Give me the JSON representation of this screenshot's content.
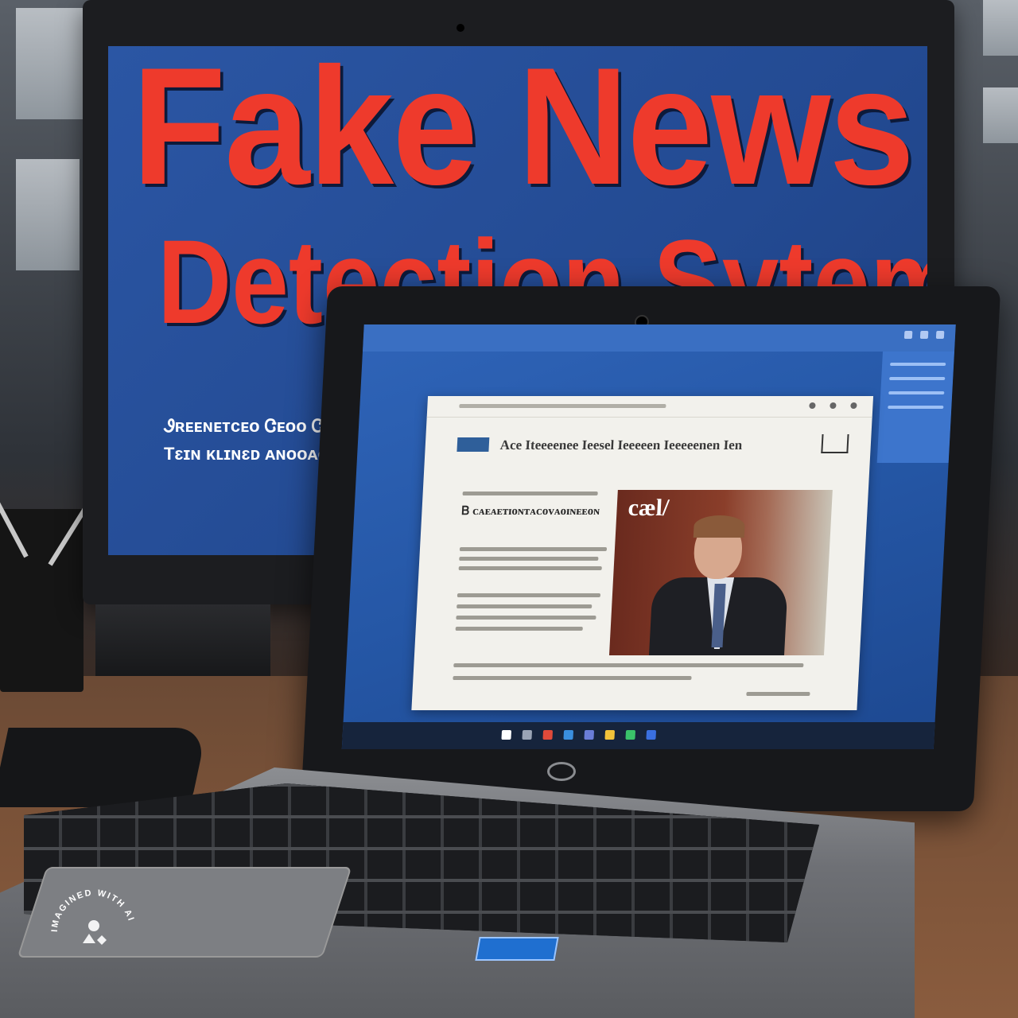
{
  "monitor": {
    "headline_line1": "Fake News",
    "headline_line2": "Detection Sytem",
    "subtitle_line1": "Ꮽʀᴇᴇɴᴇᴛᴄᴇᴏ Ꮳᴇᴏᴏ Ꮳᴇᴇ",
    "subtitle_line2": "Tɛɪɴ ᴋʟɪɴɛᴅ ᴀɴᴏᴏᴀᴏɴᴏɪ"
  },
  "laptop_screen": {
    "article_heading": "Ace Iteeeenee Ieesel Ieeeeen Ieeeeenen Ien",
    "article_subhead": "Ᏼ ᴄᴀᴇᴀᴇᴛɪᴏɴᴛᴀᴄᴏᴠᴀᴏɪɴᴇᴇᴏɴ",
    "photo_label": "cæl/"
  },
  "watermark": {
    "text": "IMAGINED WITH AI"
  },
  "colors": {
    "headline": "#ee3a2c",
    "monitor_background": "#2b56a4",
    "laptop_screen": "#2f64b8"
  }
}
